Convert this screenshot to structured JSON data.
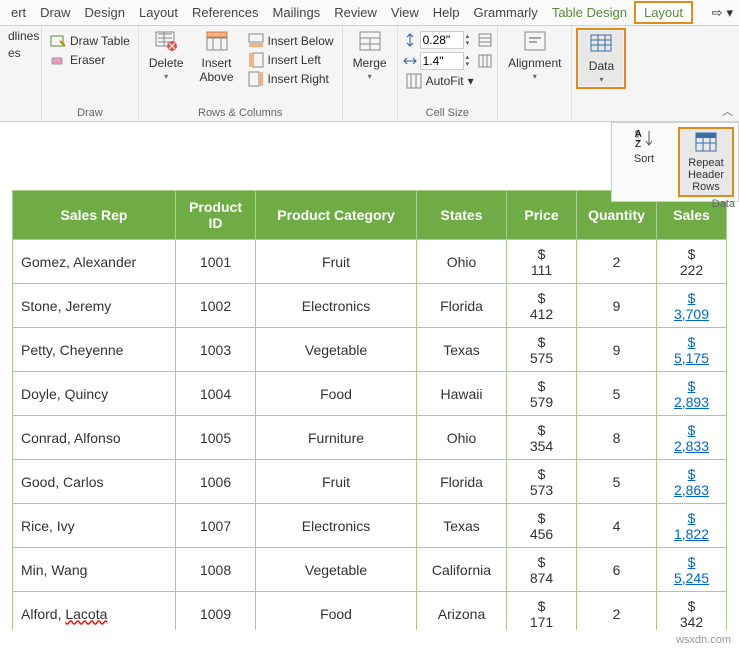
{
  "tabs": {
    "ert": "ert",
    "draw": "Draw",
    "design": "Design",
    "layout1": "Layout",
    "references": "References",
    "mailings": "Mailings",
    "review": "Review",
    "view": "View",
    "help": "Help",
    "grammarly": "Grammarly",
    "table_design": "Table Design",
    "layout2": "Layout"
  },
  "ribbon": {
    "gridlines": "dlines",
    "es": "es",
    "draw_table": "Draw Table",
    "eraser": "Eraser",
    "draw_group": "Draw",
    "delete": "Delete",
    "insert_above": "Insert\nAbove",
    "insert_below": "Insert Below",
    "insert_left": "Insert Left",
    "insert_right": "Insert Right",
    "rows_cols_group": "Rows & Columns",
    "merge": "Merge",
    "height": "0.28\"",
    "width": "1.4\"",
    "autofit": "AutoFit",
    "cell_size_group": "Cell Size",
    "alignment": "Alignment",
    "data": "Data"
  },
  "dropdown": {
    "sort": "Sort",
    "repeat": "Repeat\nHeader Rows",
    "label": "Data"
  },
  "table": {
    "headers": [
      "Sales Rep",
      "Product ID",
      "Product Category",
      "States",
      "Price",
      "Quantity",
      "Sales"
    ],
    "rows": [
      {
        "rep": "Gomez, Alexander",
        "pid": "1001",
        "cat": "Fruit",
        "state": "Ohio",
        "price": "$\n111",
        "qty": "2",
        "sales": "$\n222",
        "link": false,
        "wavy": false
      },
      {
        "rep": "Stone, Jeremy",
        "pid": "1002",
        "cat": "Electronics",
        "state": "Florida",
        "price": "$\n412",
        "qty": "9",
        "sales": "$\n3,709",
        "link": true,
        "wavy": false
      },
      {
        "rep": "Petty, Cheyenne",
        "pid": "1003",
        "cat": "Vegetable",
        "state": "Texas",
        "price": "$\n575",
        "qty": "9",
        "sales": "$\n5,175",
        "link": true,
        "wavy": false
      },
      {
        "rep": "Doyle, Quincy",
        "pid": "1004",
        "cat": "Food",
        "state": "Hawaii",
        "price": "$\n579",
        "qty": "5",
        "sales": "$\n2,893",
        "link": true,
        "wavy": false
      },
      {
        "rep": "Conrad, Alfonso",
        "pid": "1005",
        "cat": "Furniture",
        "state": "Ohio",
        "price": "$\n354",
        "qty": "8",
        "sales": "$\n2,833",
        "link": true,
        "wavy": false
      },
      {
        "rep": "Good, Carlos",
        "pid": "1006",
        "cat": "Fruit",
        "state": "Florida",
        "price": "$\n573",
        "qty": "5",
        "sales": "$\n2,863",
        "link": true,
        "wavy": false
      },
      {
        "rep": "Rice, Ivy",
        "pid": "1007",
        "cat": "Electronics",
        "state": "Texas",
        "price": "$\n456",
        "qty": "4",
        "sales": "$\n1,822",
        "link": true,
        "wavy": false
      },
      {
        "rep": "Min, Wang",
        "pid": "1008",
        "cat": "Vegetable",
        "state": "California",
        "price": "$\n874",
        "qty": "6",
        "sales": "$\n5,245",
        "link": true,
        "wavy": false
      },
      {
        "rep": "Alford, Lacota",
        "pid": "1009",
        "cat": "Food",
        "state": "Arizona",
        "price": "$\n171",
        "qty": "2",
        "sales": "$\n342",
        "link": false,
        "wavy": true
      }
    ]
  },
  "watermark": "wsxdn.com"
}
